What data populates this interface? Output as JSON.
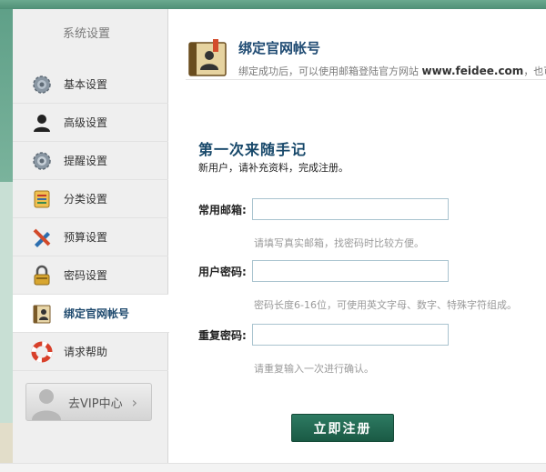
{
  "sidebar": {
    "title": "系统设置",
    "items": [
      {
        "label": "基本设置",
        "icon": "gear-icon"
      },
      {
        "label": "高级设置",
        "icon": "user-silhouette-icon"
      },
      {
        "label": "提醒设置",
        "icon": "gear-icon"
      },
      {
        "label": "分类设置",
        "icon": "category-icon"
      },
      {
        "label": "预算设置",
        "icon": "pencil-ruler-icon"
      },
      {
        "label": "密码设置",
        "icon": "padlock-icon"
      },
      {
        "label": "绑定官网帐号",
        "icon": "address-book-icon"
      },
      {
        "label": "请求帮助",
        "icon": "lifebuoy-icon"
      }
    ],
    "active_index": 6,
    "vip": {
      "label": "去VIP中心",
      "chevron": "›"
    }
  },
  "header": {
    "title": "绑定官网帐号",
    "subtitle_prefix": "绑定成功后，可以使用邮箱登陆官方网站 ",
    "subtitle_site": "www.feidee.com",
    "subtitle_suffix": "，也可"
  },
  "form": {
    "title": "第一次来随手记",
    "subtitle": "新用户，请补充资料，完成注册。",
    "fields": [
      {
        "label": "常用邮箱:",
        "value": "",
        "placeholder": "",
        "hint": "请填写真实邮箱，找密码时比较方便。"
      },
      {
        "label": "用户密码:",
        "value": "",
        "placeholder": "",
        "hint": "密码长度6-16位，可使用英文字母、数字、特殊字符组成。"
      },
      {
        "label": "重复密码:",
        "value": "",
        "placeholder": "",
        "hint": "请重复输入一次进行确认。"
      }
    ],
    "submit_label": "立即注册"
  },
  "colors": {
    "accent": "#1e4a72",
    "button": "#1f6650",
    "top_bar": "#5a9c82"
  }
}
